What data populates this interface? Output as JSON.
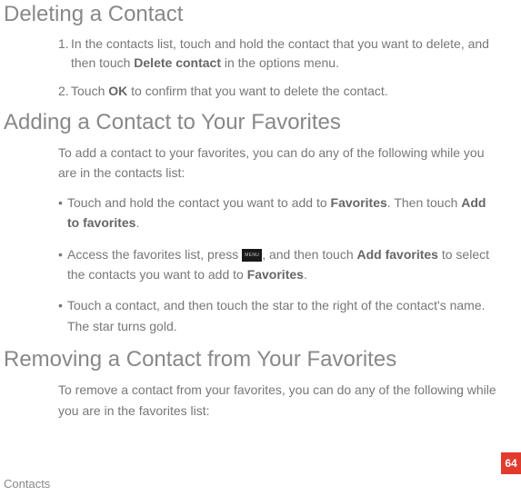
{
  "sections": {
    "deleting": {
      "heading": "Deleting a Contact",
      "step1_num": "1.",
      "step1_a": "In the contacts list, touch and hold the contact that you want to delete, and then touch ",
      "step1_bold": "Delete contact",
      "step1_b": " in the options menu.",
      "step2_num": "2.",
      "step2_a": "Touch ",
      "step2_bold": "OK",
      "step2_b": " to confirm that you want to delete the contact."
    },
    "adding": {
      "heading": "Adding a Contact to Your Favorites",
      "intro": "To add a contact to your favorites, you can do any of the following while you are in the contacts list:",
      "b1_a": "Touch and hold the contact you want to add to ",
      "b1_bold1": "Favorites",
      "b1_b": ". Then touch ",
      "b1_bold2": "Add to favorites",
      "b1_c": ".",
      "b2_a": "Access the favorites list, press ",
      "b2_icon": "MENU",
      "b2_b": ", and then touch ",
      "b2_bold1": "Add favorites",
      "b2_c": " to select the contacts you want to add to ",
      "b2_bold2": "Favorites",
      "b2_d": ".",
      "b3": "Touch a contact, and then touch the star to the right of the contact's name. The star turns gold."
    },
    "removing": {
      "heading": "Removing a Contact from Your Favorites",
      "intro": "To remove a contact from your favorites, you can do any of the following while you are in the favorites list:"
    }
  },
  "bullet_char": "•",
  "page_number": "64",
  "footer": "Contacts"
}
